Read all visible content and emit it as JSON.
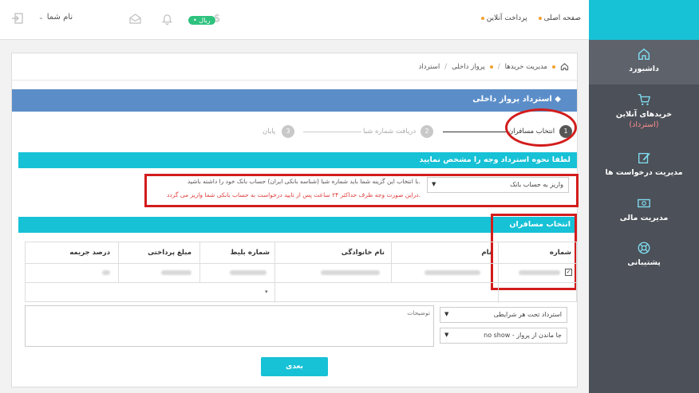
{
  "header": {
    "links": [
      "صفحه اصلی",
      "پرداخت آنلاین"
    ],
    "user_name": "نام شما",
    "balance": "• ریال",
    "dollar": "$"
  },
  "sidebar": {
    "items": [
      {
        "label": "داشبورد",
        "icon": "home-icon"
      },
      {
        "label": "خریدهای آنلاین",
        "sub": "(استرداد)",
        "icon": "cart-icon"
      },
      {
        "label": "مدیریت درخواست ها",
        "icon": "edit-icon"
      },
      {
        "label": "مدیریت مالی",
        "icon": "money-icon"
      },
      {
        "label": "پشتیبانی",
        "icon": "support-icon"
      }
    ]
  },
  "breadcrumb": [
    "مدیریت خریدها",
    "پرواز داخلی",
    "استرداد"
  ],
  "page_title": "استرداد پرواز داخلی",
  "steps": [
    {
      "num": "1",
      "label": "انتخاب مسافران"
    },
    {
      "num": "2",
      "label": "دریافت شماره شبا"
    },
    {
      "num": "3",
      "label": "پایان"
    }
  ],
  "refund_section": {
    "title": "لطفا نحوه استرداد وجه را مشخص نمایید",
    "method_value": "واریز به حساب بانک",
    "hint": "با انتخاب این گزینه شما باید شماره شبا (شناسه بانکی ایران) حساب بانک خود را داشته باشید.",
    "hint_red": "دراین صورت وجه ظرف حداکثر ۲۴ ساعت پس از تایید درخواست به حساب بانکی شما واریز می گردد."
  },
  "passengers_section": {
    "title": "انتخاب مسافران",
    "columns": [
      "شماره",
      "نام",
      "نام خانوادگی",
      "شماره بلیط",
      "مبلغ پرداختی",
      "درصد جریمه"
    ]
  },
  "refund_condition": "استرداد تحت هر شرایطی",
  "no_show": "no show - جا ماندن از پرواز",
  "notes_placeholder": "توضیحات",
  "next_label": "بعدی",
  "colors": {
    "accent": "#17c1d6",
    "title_bar": "#5b8ec9",
    "sidebar": "#4c5058",
    "highlight": "#d21c1c"
  }
}
